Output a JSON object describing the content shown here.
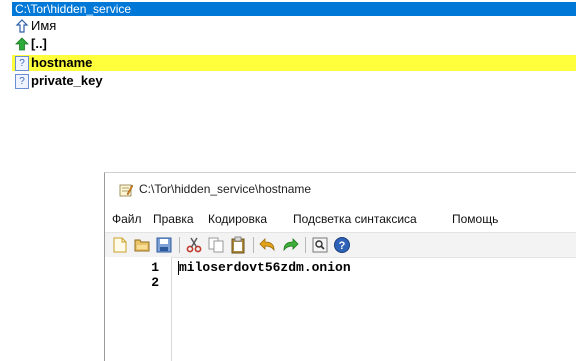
{
  "path_bar": {
    "text": "C:\\Tor\\hidden_service"
  },
  "file_list": {
    "header_label": "Имя",
    "items": [
      {
        "name": "[..]"
      },
      {
        "name": "hostname"
      },
      {
        "name": "private_key"
      }
    ]
  },
  "editor": {
    "title": "C:\\Tor\\hidden_service\\hostname",
    "menu": [
      "Файл",
      "Правка",
      "Кодировка",
      "Подсветка синтаксиса",
      "Помощь"
    ],
    "lines": [
      {
        "number": "1",
        "text": "miloserdovt56zdm.onion"
      },
      {
        "number": "2",
        "text": ""
      }
    ]
  },
  "colors": {
    "path_bar": "#0078d7",
    "selection": "#ffff3c"
  }
}
